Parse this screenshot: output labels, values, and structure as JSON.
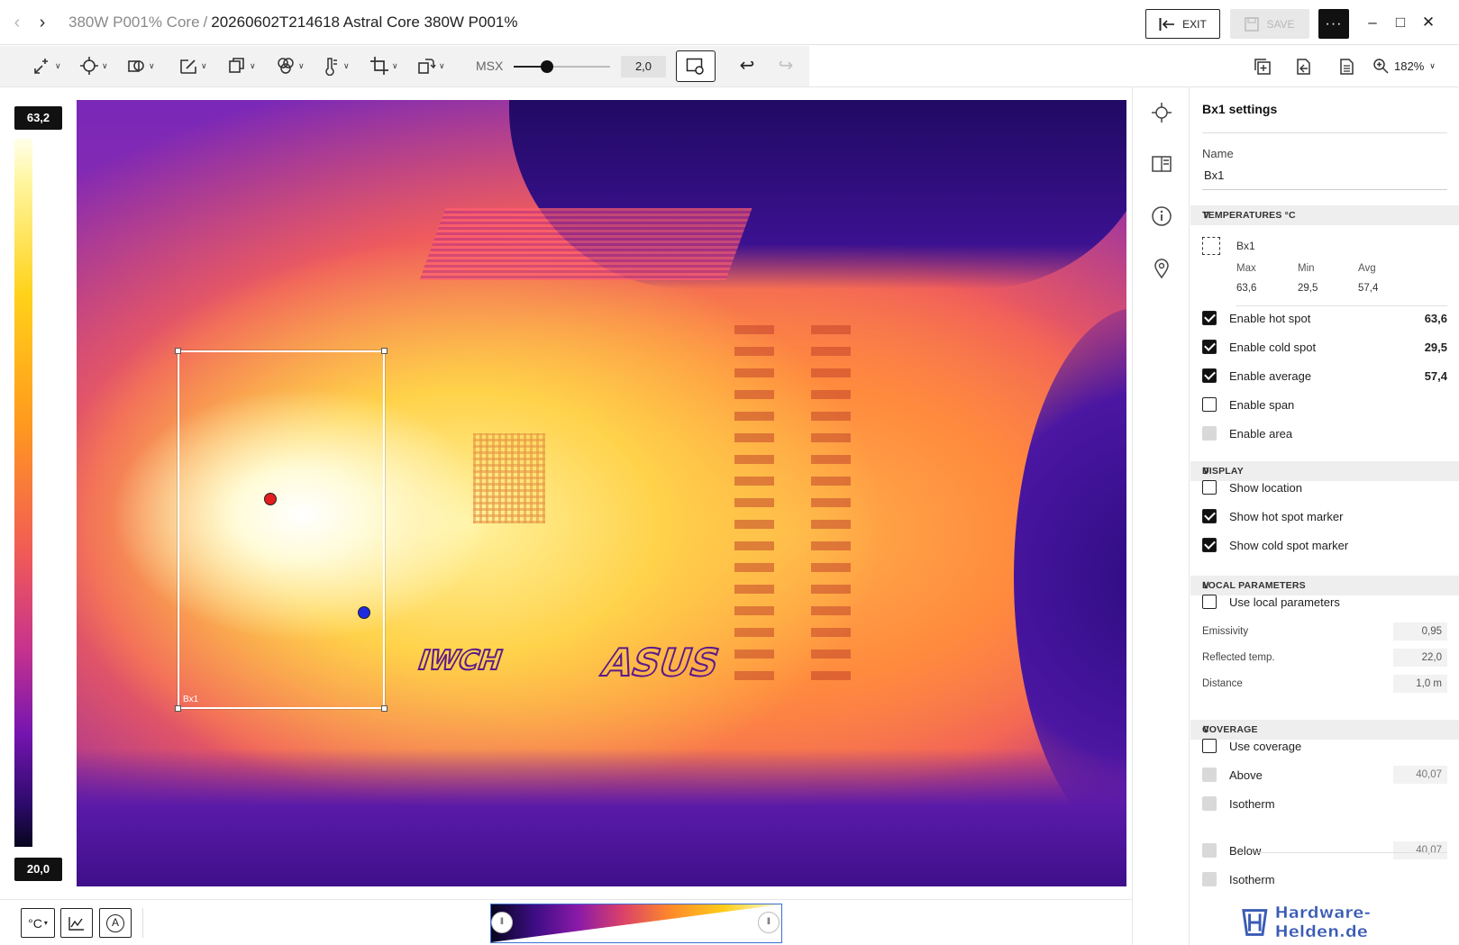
{
  "titlebar": {
    "breadcrumb_parent": "380W P001% Core",
    "breadcrumb_sep": "/",
    "breadcrumb_current": "20260602T214618 Astral Core 380W P001%",
    "exit_label": "EXIT",
    "save_label": "SAVE",
    "more_label": "···"
  },
  "toolbar": {
    "msx_label": "MSX",
    "msx_value": "2,0",
    "msx_level": 0.35,
    "zoom_label": "182%"
  },
  "scale": {
    "max": "63,2",
    "min": "20,0"
  },
  "image": {
    "box_label": "Bx1"
  },
  "bottom": {
    "unit_label": "°C",
    "auto_label": "A"
  },
  "panel": {
    "title": "Bx1 settings",
    "name_label": "Name",
    "name_value": "Bx1",
    "temps_section": "TEMPERATURES °C",
    "temps": {
      "item": "Bx1",
      "max_h": "Max",
      "min_h": "Min",
      "avg_h": "Avg",
      "max": "63,6",
      "min": "29,5",
      "avg": "57,4"
    },
    "measure_rows": [
      {
        "label": "Enable hot spot",
        "value": "63,6",
        "state": "checked"
      },
      {
        "label": "Enable cold spot",
        "value": "29,5",
        "state": "checked"
      },
      {
        "label": "Enable average",
        "value": "57,4",
        "state": "checked"
      },
      {
        "label": "Enable span",
        "value": "",
        "state": "unchecked"
      },
      {
        "label": "Enable area",
        "value": "",
        "state": "disabled"
      }
    ],
    "display_section": "DISPLAY",
    "display_rows": [
      {
        "label": "Show location",
        "state": "unchecked"
      },
      {
        "label": "Show hot spot marker",
        "state": "checked"
      },
      {
        "label": "Show cold spot marker",
        "state": "checked"
      }
    ],
    "local_section": "LOCAL PARAMETERS",
    "local_row": {
      "label": "Use local parameters",
      "state": "unchecked"
    },
    "params": [
      {
        "label": "Emissivity",
        "value": "0,95"
      },
      {
        "label": "Reflected temp.",
        "value": "22,0"
      },
      {
        "label": "Distance",
        "value": "1,0 m"
      }
    ],
    "coverage_section": "COVERAGE",
    "coverage_rows": [
      {
        "label": "Use coverage",
        "state": "unchecked",
        "value": ""
      },
      {
        "label": "Above",
        "state": "disabled",
        "value": "40,07"
      },
      {
        "label": "Isotherm",
        "state": "disabled",
        "value": ""
      },
      {
        "label": "Below",
        "state": "disabled",
        "value": "40,07"
      },
      {
        "label": "Isotherm",
        "state": "disabled",
        "value": ""
      }
    ]
  },
  "watermark": "Hardware-Helden.de",
  "colors": {
    "hot_marker": "#e21e1e",
    "cold_marker": "#1f2be0",
    "accent_blue": "#3b6fd1"
  }
}
